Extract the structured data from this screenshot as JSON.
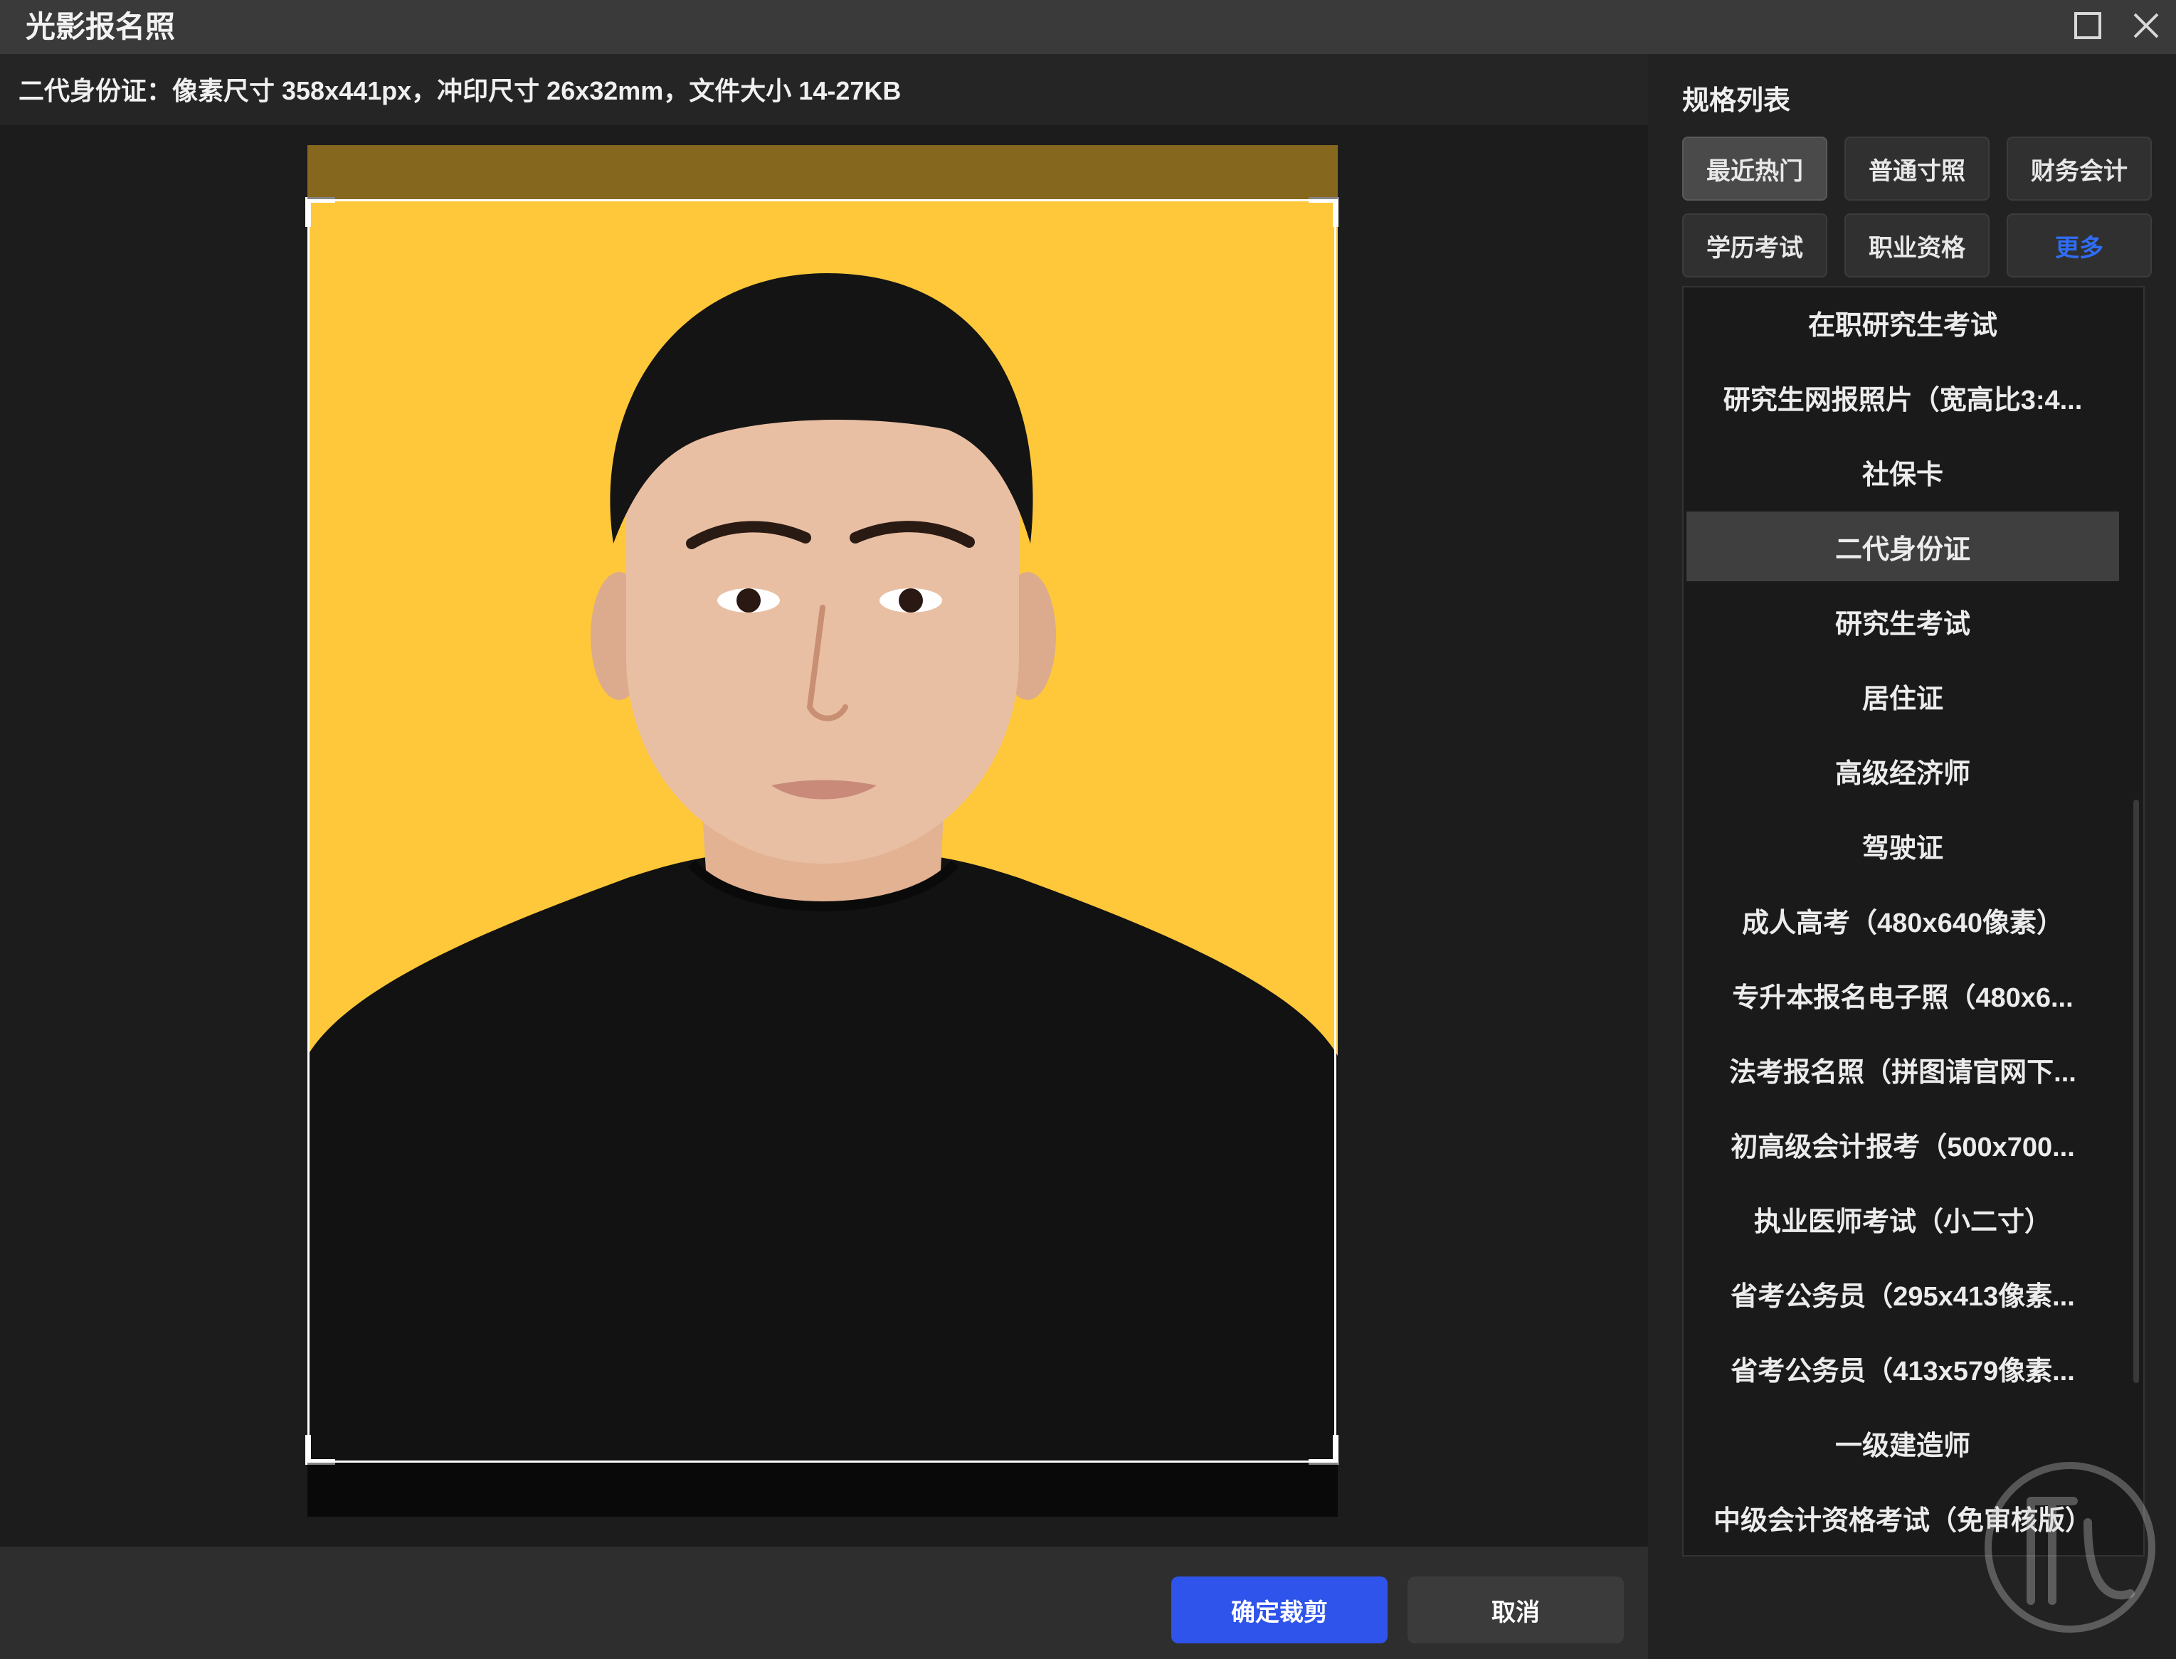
{
  "window": {
    "title": "光影报名照",
    "maximize_icon": "maximize-icon",
    "close_icon": "close-icon"
  },
  "spec_info": "二代身份证：像素尺寸 358x441px，冲印尺寸 26x32mm，文件大小 14-27KB",
  "photo": {
    "background_color": "#ffc83a",
    "shirt_color": "#111111",
    "skin_color": "#e9bfa3",
    "hair_color": "#141414"
  },
  "footer": {
    "confirm_label": "确定裁剪",
    "cancel_label": "取消"
  },
  "right_panel": {
    "title": "规格列表",
    "categories": [
      {
        "label": "最近热门",
        "active": true
      },
      {
        "label": "普通寸照",
        "active": false
      },
      {
        "label": "财务会计",
        "active": false
      },
      {
        "label": "学历考试",
        "active": false
      },
      {
        "label": "职业资格",
        "active": false
      },
      {
        "label": "更多",
        "active": false
      }
    ],
    "specs": [
      "在职研究生考试",
      "研究生网报照片（宽高比3:4...",
      "社保卡",
      "二代身份证",
      "研究生考试",
      "居住证",
      "高级经济师",
      "驾驶证",
      "成人高考（480x640像素）",
      "专升本报名电子照（480x6...",
      "法考报名照（拼图请官网下...",
      "初高级会计报考（500x700...",
      "执业医师考试（小二寸）",
      "省考公务员（295x413像素...",
      "省考公务员（413x579像素...",
      "一级建造师",
      "中级会计资格考试（免审核版）"
    ],
    "selected_spec": "二代身份证"
  },
  "colors": {
    "accent": "#2f54eb",
    "more_link": "#2f6df6"
  }
}
